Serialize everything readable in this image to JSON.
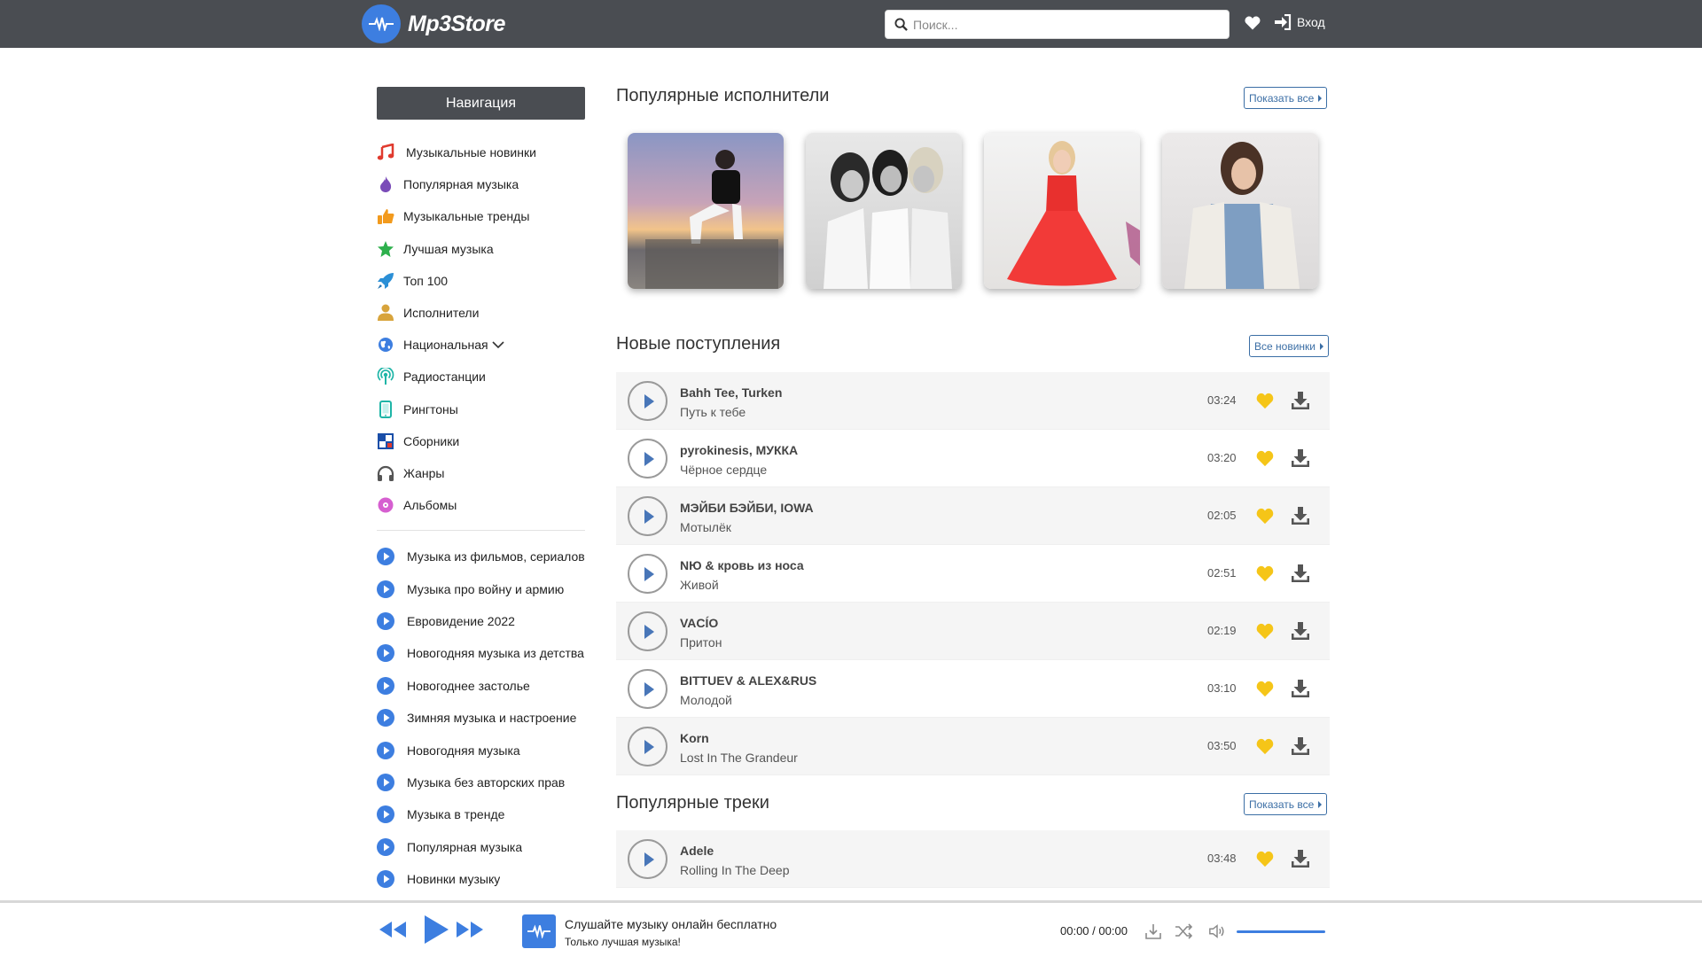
{
  "header": {
    "logo_text": "Mp3Store",
    "search_placeholder": "Поиск...",
    "login_label": "Вход"
  },
  "sidebar": {
    "title": "Навигация",
    "items": [
      {
        "label": "Музыкальные новинки",
        "icon": "music-note-icon"
      },
      {
        "label": "Популярная музыка",
        "icon": "flame-icon"
      },
      {
        "label": "Музыкальные тренды",
        "icon": "thumbs-up-icon"
      },
      {
        "label": "Лучшая музыка",
        "icon": "star-icon"
      },
      {
        "label": "Топ 100",
        "icon": "rocket-icon"
      },
      {
        "label": "Исполнители",
        "icon": "user-icon"
      },
      {
        "label": "Национальная",
        "icon": "globe-icon"
      },
      {
        "label": "Радиостанции",
        "icon": "radio-icon"
      },
      {
        "label": "Рингтоны",
        "icon": "phone-icon"
      },
      {
        "label": "Сборники",
        "icon": "collection-icon"
      },
      {
        "label": "Жанры",
        "icon": "headphones-icon"
      },
      {
        "label": "Альбомы",
        "icon": "disc-icon"
      }
    ],
    "playlists": [
      "Музыка из фильмов, сериалов",
      "Музыка про войну и армию",
      "Евровидение 2022",
      "Новогодняя музыка из детства",
      "Новогоднее застолье",
      "Зимняя музыка и настроение",
      "Новогодняя музыка",
      "Музыка без авторских прав",
      "Музыка в тренде",
      "Популярная музыка",
      "Новинки музыку"
    ]
  },
  "popular_artists": {
    "title": "Популярные исполнители",
    "button": "Показать все"
  },
  "new_arrivals": {
    "title": "Новые поступления",
    "button": "Все новинки",
    "tracks": [
      {
        "artist": "Bahh Tee, Turken",
        "song": "Путь к тебе",
        "duration": "03:24"
      },
      {
        "artist": "pyrokinesis, МУККА",
        "song": "Чёрное сердце",
        "duration": "03:20"
      },
      {
        "artist": "МЭЙБИ БЭЙБИ, IOWA",
        "song": "Мотылёк",
        "duration": "02:05"
      },
      {
        "artist": "NЮ & кровь из носа",
        "song": "Живой",
        "duration": "02:51"
      },
      {
        "artist": "VACÍO",
        "song": "Притон",
        "duration": "02:19"
      },
      {
        "artist": "BITTUEV & ALEX&RUS",
        "song": "Молодой",
        "duration": "03:10"
      },
      {
        "artist": "Korn",
        "song": "Lost In The Grandeur",
        "duration": "03:50"
      }
    ]
  },
  "popular_tracks": {
    "title": "Популярные треки",
    "button": "Показать все",
    "tracks": [
      {
        "artist": "Adele",
        "song": "Rolling In The Deep",
        "duration": "03:48"
      }
    ]
  },
  "player": {
    "title": "Слушайте музыку онлайн бесплатно",
    "subtitle": "Только лучшая музыка!",
    "current_time": "00:00",
    "separator": "/",
    "total_time": "00:00",
    "volume": 1.0
  },
  "colors": {
    "header_bg": "#4a4d52",
    "accent": "#3d7ee0",
    "heart": "#f5c518"
  }
}
